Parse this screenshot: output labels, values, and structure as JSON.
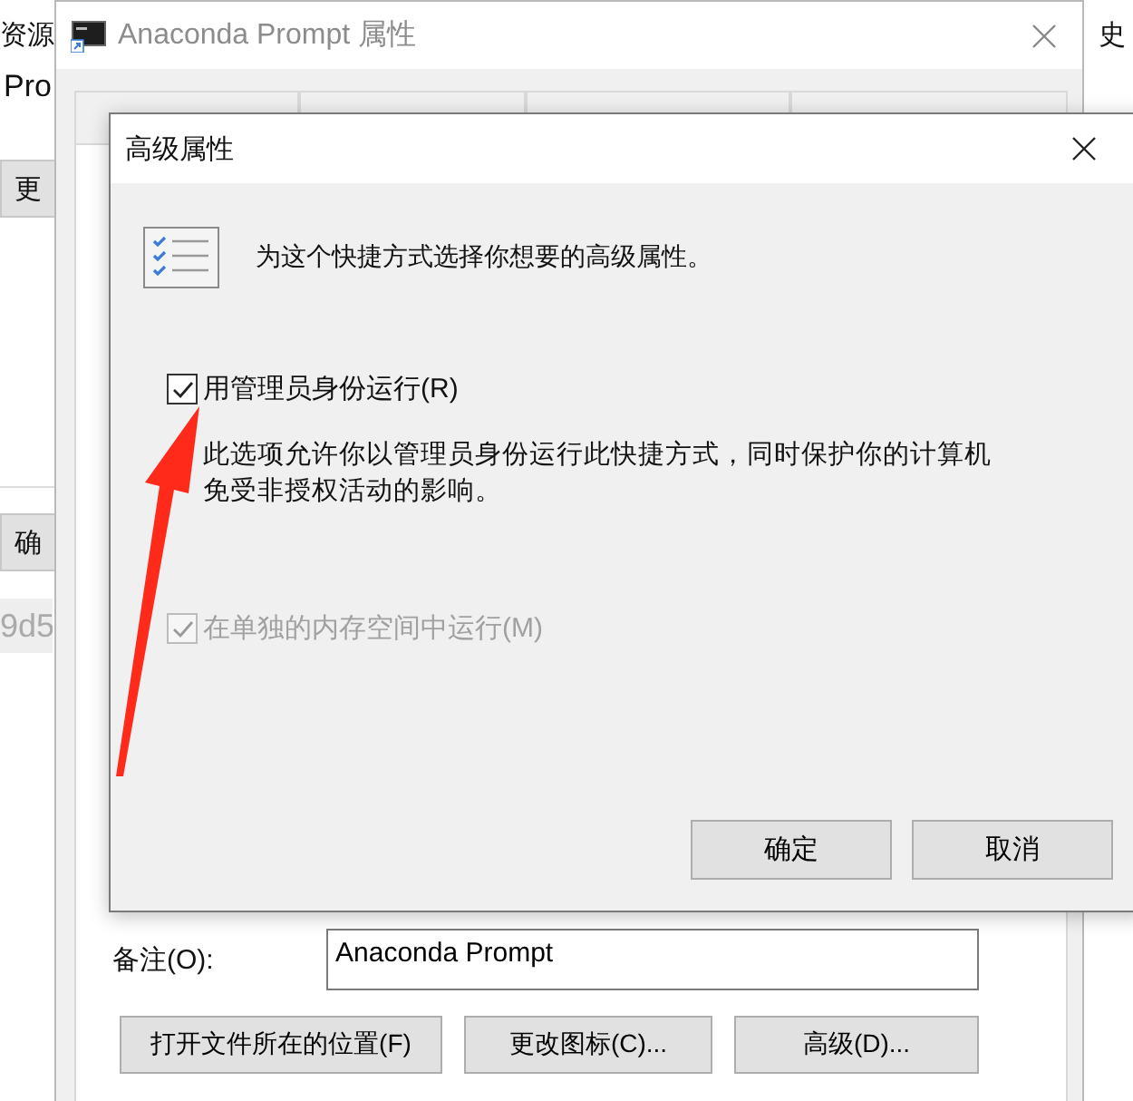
{
  "background_app": {
    "fragments": [
      {
        "kind": "text",
        "text": "资源"
      },
      {
        "kind": "text",
        "text": "Pro"
      },
      {
        "kind": "button",
        "text": "更"
      },
      {
        "kind": "button",
        "text": "确"
      },
      {
        "kind": "field",
        "text": "9d5"
      },
      {
        "kind": "text",
        "text": "史"
      }
    ]
  },
  "properties_window": {
    "title": "Anaconda Prompt 属性",
    "comment": {
      "label": "备注(O):",
      "value": "Anaconda Prompt"
    },
    "buttons": [
      "打开文件所在的位置(F)",
      "更改图标(C)...",
      "高级(D)..."
    ]
  },
  "advanced_dialog": {
    "title": "高级属性",
    "intro": "为这个快捷方式选择你想要的高级属性。",
    "options": [
      {
        "label": "用管理员身份运行(R)",
        "checked": true,
        "disabled": false,
        "description": "此选项允许你以管理员身份运行此快捷方式，同时保护你的计算机免受非授权活动的影响。"
      },
      {
        "label": "在单独的内存空间中运行(M)",
        "checked": true,
        "disabled": true
      }
    ],
    "buttons": [
      "确定",
      "取消"
    ]
  },
  "annotation": {
    "kind": "arrow"
  }
}
